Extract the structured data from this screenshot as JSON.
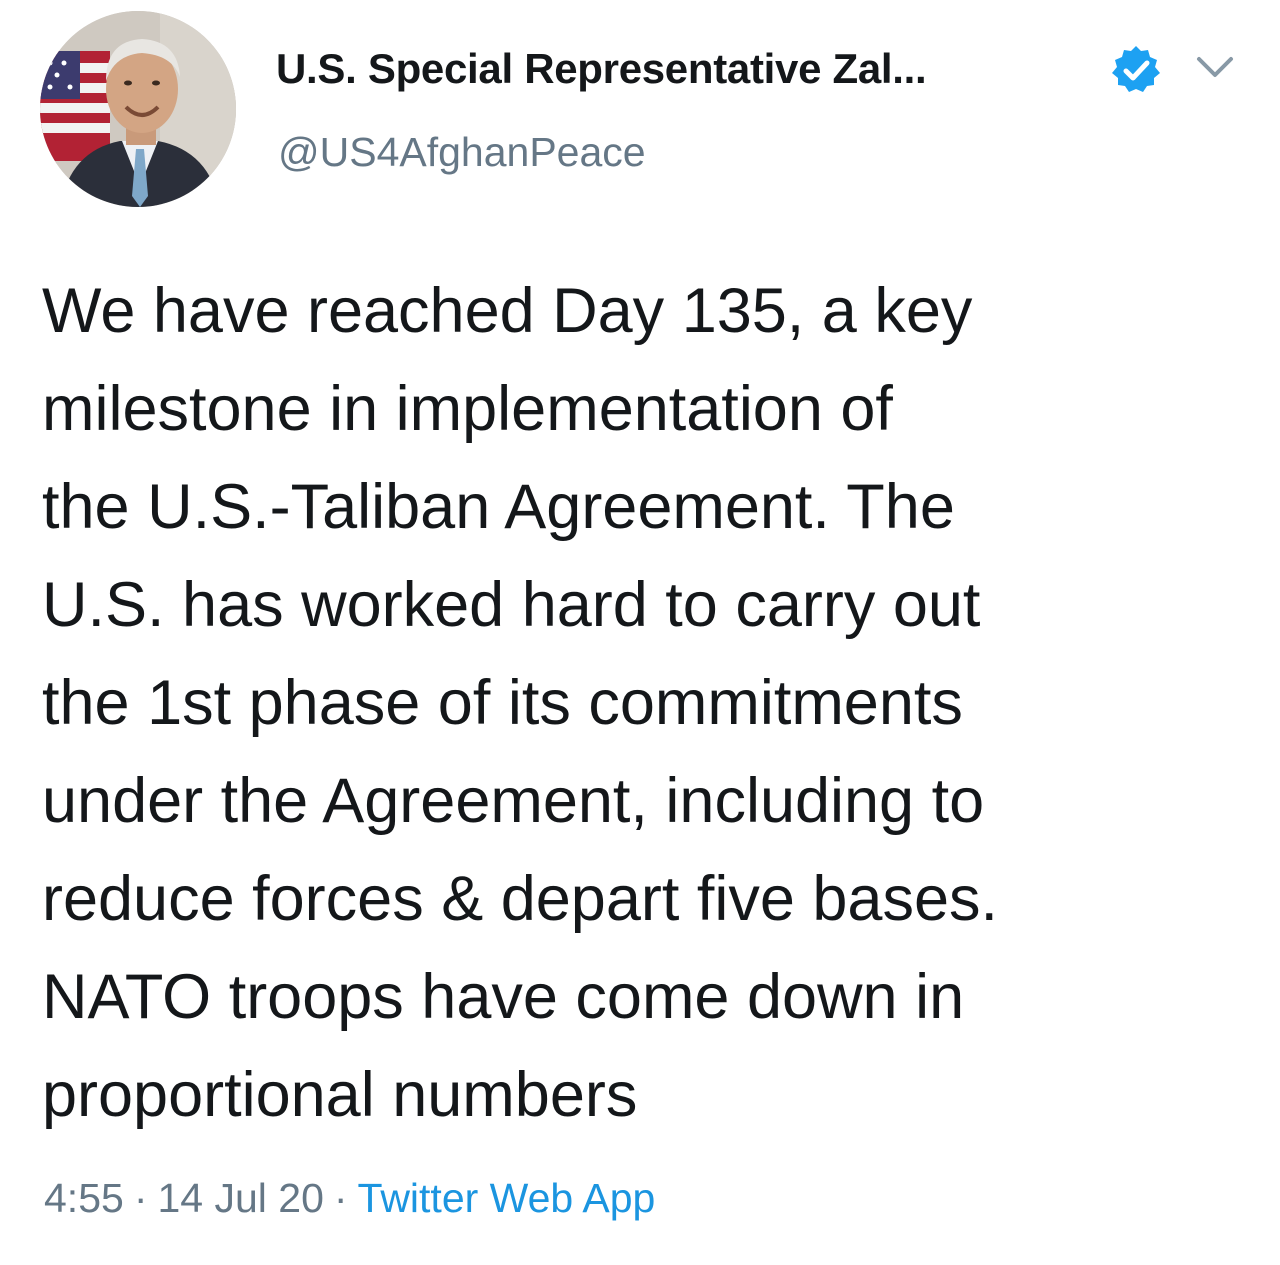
{
  "tweet": {
    "author": {
      "display_name": "U.S. Special Representative Zal...",
      "handle": "@US4AfghanPeace",
      "avatar_icon": "profile-photo",
      "verified_icon": "verified-badge-icon",
      "verified_color": "#1da1f2"
    },
    "menu_icon": "chevron-down-icon",
    "text_lines": [
      "We have reached Day 135, a key",
      "milestone in implementation of",
      "the U.S.-Taliban Agreement. The",
      "U.S. has worked hard to carry out",
      "the 1st phase of its commitments",
      "under the Agreement, including to",
      "reduce forces & depart five bases.",
      "NATO troops have come down in",
      "proportional numbers"
    ],
    "meta": {
      "time": "4:55",
      "separator": "·",
      "date": "14 Jul 20",
      "source": "Twitter Web App",
      "source_color": "#1b95e0"
    }
  }
}
